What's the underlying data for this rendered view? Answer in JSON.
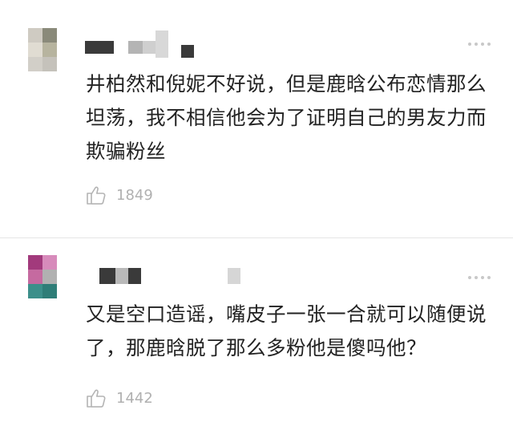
{
  "colors": {
    "text": "#222222",
    "muted": "#b0b0b0",
    "divider": "#e6e6e6"
  },
  "comments": [
    {
      "avatar_colors": [
        "#cfcbc2",
        "#8a8a7a",
        "#e0dcd2",
        "#b7b49f",
        "#d2cfc8",
        "#c5c2bb"
      ],
      "text": "井柏然和倪妮不好说，但是鹿晗公布恋情那么坦荡，我不相信他会为了证明自己的男友力而欺骗粉丝",
      "like_icon": "thumbs-up-icon",
      "likes": "1849"
    },
    {
      "avatar_colors": [
        "#a23a7c",
        "#d78bbb",
        "#c56aa0",
        "#b1b1b1",
        "#3c8f8a",
        "#2f7e78"
      ],
      "text": "又是空口造谣，嘴皮子一张一合就可以随便说了，那鹿晗脱了那么多粉他是傻吗他？",
      "like_icon": "thumbs-up-icon",
      "likes": "1442"
    }
  ]
}
